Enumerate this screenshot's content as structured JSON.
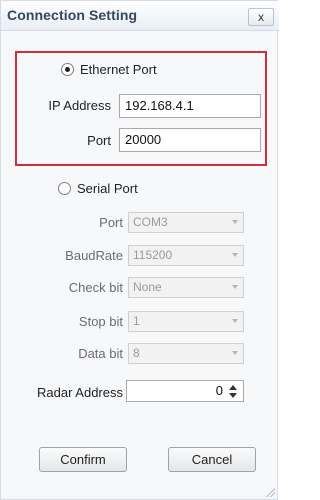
{
  "window": {
    "title": "Connection Setting",
    "close_label": "x"
  },
  "ethernet": {
    "label": "Ethernet Port",
    "selected": true,
    "ip_label": "IP Address",
    "ip_value": "192.168.4.1",
    "port_label": "Port",
    "port_value": "20000"
  },
  "serial": {
    "label": "Serial Port",
    "selected": false,
    "port_label": "Port",
    "port_value": "COM3",
    "baudrate_label": "BaudRate",
    "baudrate_value": "115200",
    "checkbit_label": "Check bit",
    "checkbit_value": "None",
    "stopbit_label": "Stop bit",
    "stopbit_value": "1",
    "databit_label": "Data bit",
    "databit_value": "8"
  },
  "radar": {
    "label": "Radar Address",
    "value": "0"
  },
  "buttons": {
    "confirm": "Confirm",
    "cancel": "Cancel"
  },
  "colors": {
    "highlight_border": "#cf2e3a",
    "title_text": "#34475f"
  }
}
